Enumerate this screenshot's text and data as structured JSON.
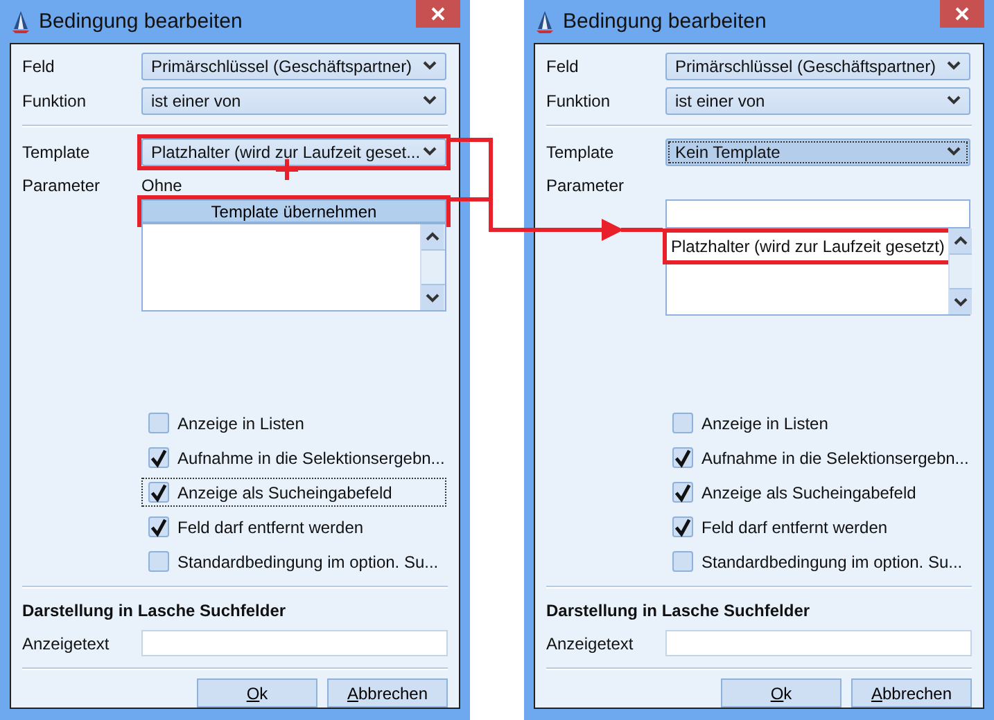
{
  "dialogs": [
    {
      "title": "Bedingung bearbeiten",
      "fields": [
        {
          "label": "Feld",
          "value": "Primärschlüssel (Geschäftspartner)"
        },
        {
          "label": "Funktion",
          "value": "ist einer von"
        }
      ],
      "template": {
        "label": "Template",
        "value": "Platzhalter (wird zur Laufzeit geset...",
        "focused": false,
        "highlighted": true
      },
      "parameter": {
        "label": "Parameter",
        "value": "Ohne"
      },
      "apply_button": {
        "label": "Template übernehmen",
        "highlighted": true
      },
      "checkboxes": [
        {
          "label": "Anzeige in Listen",
          "checked": false,
          "focused": false
        },
        {
          "label": "Aufnahme in die Selektionsergebn...",
          "checked": true,
          "focused": false
        },
        {
          "label": "Anzeige als Sucheingabefeld",
          "checked": true,
          "focused": true
        },
        {
          "label": "Feld darf entfernt werden",
          "checked": true,
          "focused": false
        },
        {
          "label": "Standardbedingung im option. Su...",
          "checked": false,
          "focused": false
        }
      ],
      "section_title": "Darstellung in Lasche Suchfelder",
      "display_text": {
        "label": "Anzeigetext"
      },
      "buttons": [
        "Ok",
        "Abbrechen"
      ]
    },
    {
      "title": "Bedingung bearbeiten",
      "fields": [
        {
          "label": "Feld",
          "value": "Primärschlüssel (Geschäftspartner)"
        },
        {
          "label": "Funktion",
          "value": "ist einer von"
        }
      ],
      "template": {
        "label": "Template",
        "value": "Kein Template",
        "focused": true,
        "highlighted": false
      },
      "parameter": {
        "label": "Parameter"
      },
      "parameter_list": {
        "items": [
          {
            "label": "Platzhalter (wird zur Laufzeit gesetzt)",
            "highlighted": true
          }
        ]
      },
      "checkboxes": [
        {
          "label": "Anzeige in Listen",
          "checked": false,
          "focused": false
        },
        {
          "label": "Aufnahme in die Selektionsergebn...",
          "checked": true,
          "focused": false
        },
        {
          "label": "Anzeige als Sucheingabefeld",
          "checked": true,
          "focused": false
        },
        {
          "label": "Feld darf entfernt werden",
          "checked": true,
          "focused": false
        },
        {
          "label": "Standardbedingung im option. Su...",
          "checked": false,
          "focused": false
        }
      ],
      "section_title": "Darstellung in Lasche Suchfelder",
      "display_text": {
        "label": "Anzeigetext"
      },
      "buttons": [
        "Ok",
        "Abbrechen"
      ]
    }
  ]
}
